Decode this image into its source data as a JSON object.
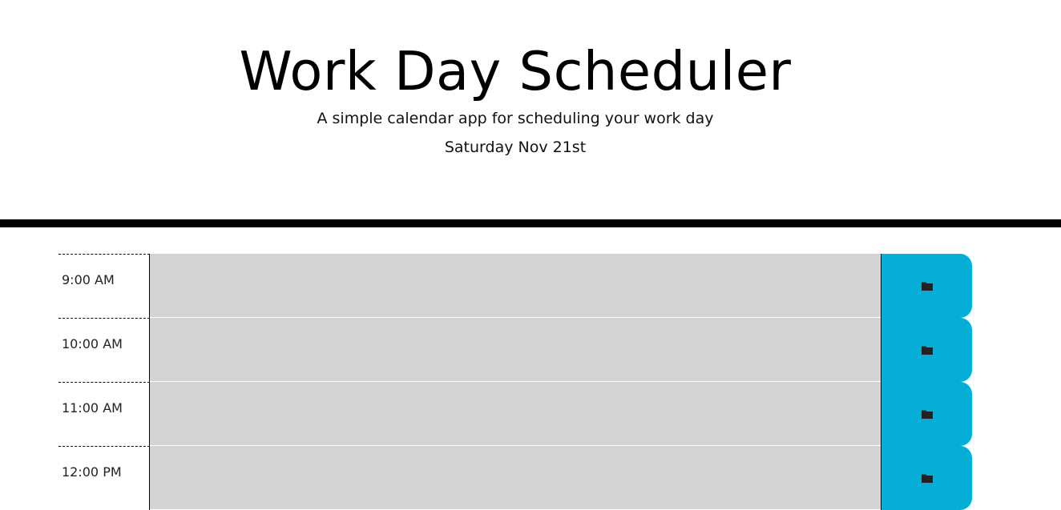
{
  "header": {
    "title": "Work Day Scheduler",
    "subtitle": "A simple calendar app for scheduling your work day",
    "current_day": "Saturday Nov 21st"
  },
  "rows": [
    {
      "hour": "9:00 AM",
      "description": "",
      "save_icon": "folder-icon"
    },
    {
      "hour": "10:00 AM",
      "description": "",
      "save_icon": "folder-icon"
    },
    {
      "hour": "11:00 AM",
      "description": "",
      "save_icon": "folder-icon"
    },
    {
      "hour": "12:00 PM",
      "description": "",
      "save_icon": "folder-icon"
    }
  ],
  "colors": {
    "past": "#d3d3d3",
    "save_button": "#06aed5",
    "divider": "#000000"
  }
}
